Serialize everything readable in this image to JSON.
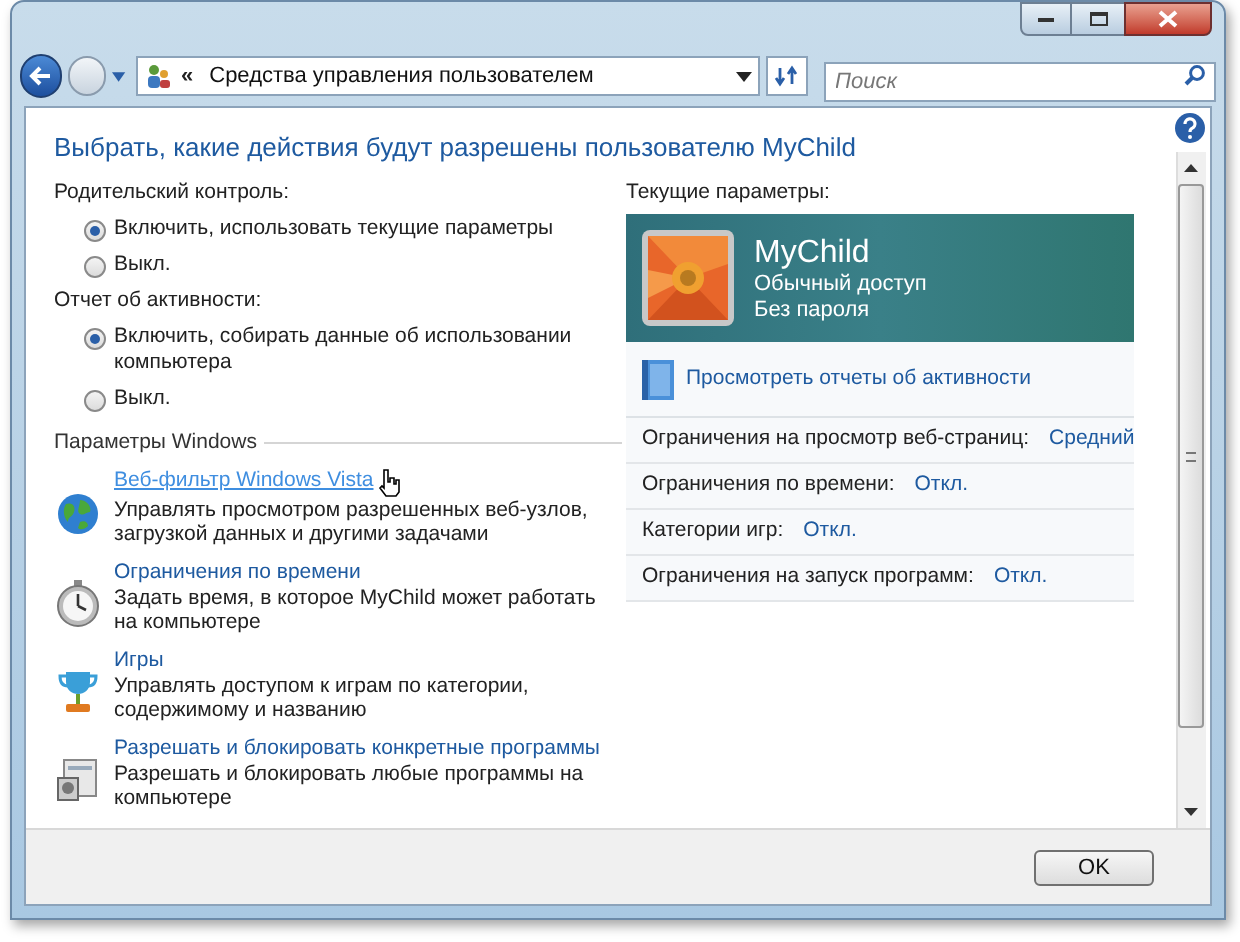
{
  "nav": {
    "breadcrumb_marker": "«",
    "address": "Средства управления пользователем",
    "search": {
      "placeholder": "Поиск"
    }
  },
  "heading": "Выбрать, какие действия будут разрешены пользователю MyChild",
  "parental_control": {
    "label": "Родительский контроль:",
    "options": [
      {
        "label": "Включить, использовать текущие параметры",
        "selected": true
      },
      {
        "label": "Выкл.",
        "selected": false
      }
    ]
  },
  "activity_report": {
    "label": "Отчет об активности:",
    "options": [
      {
        "label": "Включить, собирать данные об использовании компьютера",
        "selected": true
      },
      {
        "label": "Выкл.",
        "selected": false
      }
    ]
  },
  "windows_settings": {
    "title": "Параметры Windows",
    "items": [
      {
        "kind": "globe",
        "link": "Веб-фильтр Windows Vista",
        "description": "Управлять просмотром разрешенных веб-узлов, загрузкой данных и другими задачами",
        "hovered": true
      },
      {
        "kind": "stopwatch",
        "link": "Ограничения по времени",
        "description": "Задать время, в которое MyChild может работать на компьютере",
        "hovered": false
      },
      {
        "kind": "trophy",
        "link": "Игры",
        "description": "Управлять доступом к играм по категории, содержимому и названию",
        "hovered": false
      },
      {
        "kind": "program",
        "link": "Разрешать и блокировать конкретные программы",
        "description": "Разрешать и блокировать любые программы на компьютере",
        "hovered": false
      }
    ]
  },
  "current": {
    "label": "Текущие параметры:",
    "user": {
      "name": "MyChild",
      "account_type": "Обычный доступ",
      "password": "Без пароля"
    },
    "report_link": "Просмотреть отчеты об активности",
    "restrictions": [
      {
        "label": "Ограничения на просмотр веб-страниц:",
        "value": "Средний"
      },
      {
        "label": "Ограничения по времени:",
        "value": "Откл."
      },
      {
        "label": "Категории игр:",
        "value": "Откл."
      },
      {
        "label": "Ограничения на запуск программ:",
        "value": "Откл."
      }
    ]
  },
  "buttons": [
    "OK"
  ]
}
